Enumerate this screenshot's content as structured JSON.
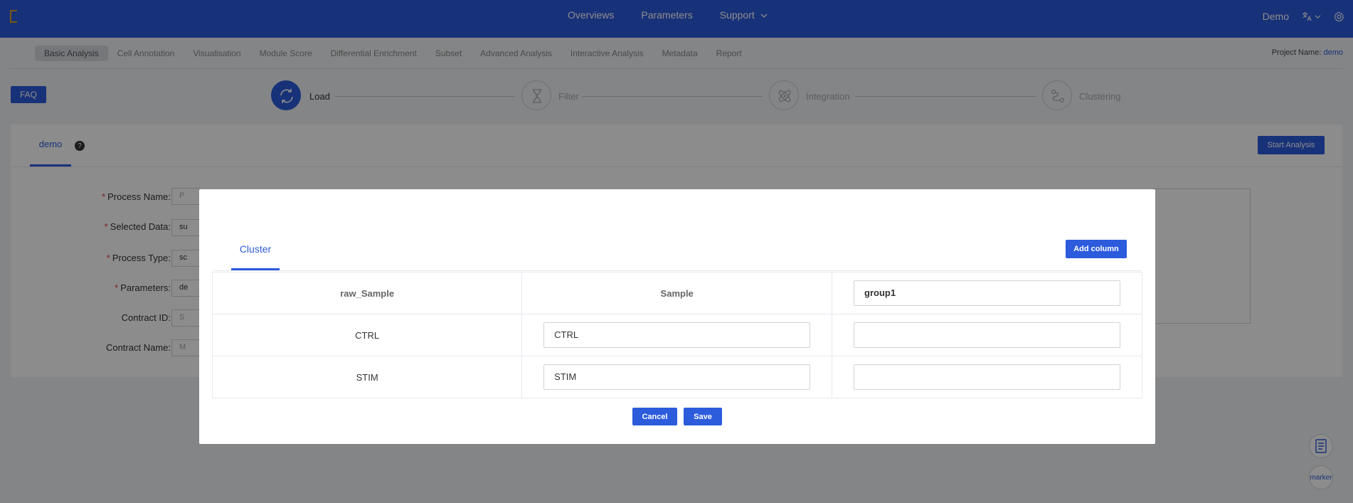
{
  "topbar": {
    "logo_text": "",
    "nav": [
      "Overviews",
      "Parameters",
      "Support"
    ],
    "user": "Demo"
  },
  "subnav": {
    "items": [
      "Basic Analysis",
      "Cell Annotation",
      "Visualisation",
      "Module Score",
      "Differential Enrichment",
      "Subset",
      "Advanced Analysis",
      "Interactive Analysis",
      "Metadata",
      "Report"
    ],
    "active_index": 0,
    "project_label": "Project Name:",
    "project_name": "demo"
  },
  "faq_label": "FAQ",
  "steps": [
    {
      "label": "Load",
      "active": true
    },
    {
      "label": "Filter",
      "active": false
    },
    {
      "label": "Integration",
      "active": false
    },
    {
      "label": "Clustering",
      "active": false
    }
  ],
  "panel": {
    "tab": "demo",
    "help": "?",
    "start_button": "Start Analysis",
    "fields": [
      {
        "label": "Process Name:",
        "required": true,
        "value": "P"
      },
      {
        "label": "Selected Data:",
        "required": true,
        "value": "su"
      },
      {
        "label": "Process Type:",
        "required": true,
        "value": "sc"
      },
      {
        "label": "Parameters:",
        "required": true,
        "value": "de"
      },
      {
        "label": "Contract ID:",
        "required": false,
        "value": "S"
      },
      {
        "label": "Contract Name:",
        "required": false,
        "value": "M"
      }
    ]
  },
  "floating": {
    "marker_label": "marker"
  },
  "modal": {
    "tab": "Cluster",
    "add_column": "Add column",
    "headers": {
      "col1": "raw_Sample",
      "col2": "Sample",
      "col3_input": "group1"
    },
    "rows": [
      {
        "raw": "CTRL",
        "sample": "CTRL",
        "group": ""
      },
      {
        "raw": "STIM",
        "sample": "STIM",
        "group": ""
      }
    ],
    "cancel": "Cancel",
    "save": "Save"
  },
  "colors": {
    "primary": "#2c5bdc",
    "required": "#e04040",
    "overlay": "rgba(0,0,0,0.45)"
  }
}
